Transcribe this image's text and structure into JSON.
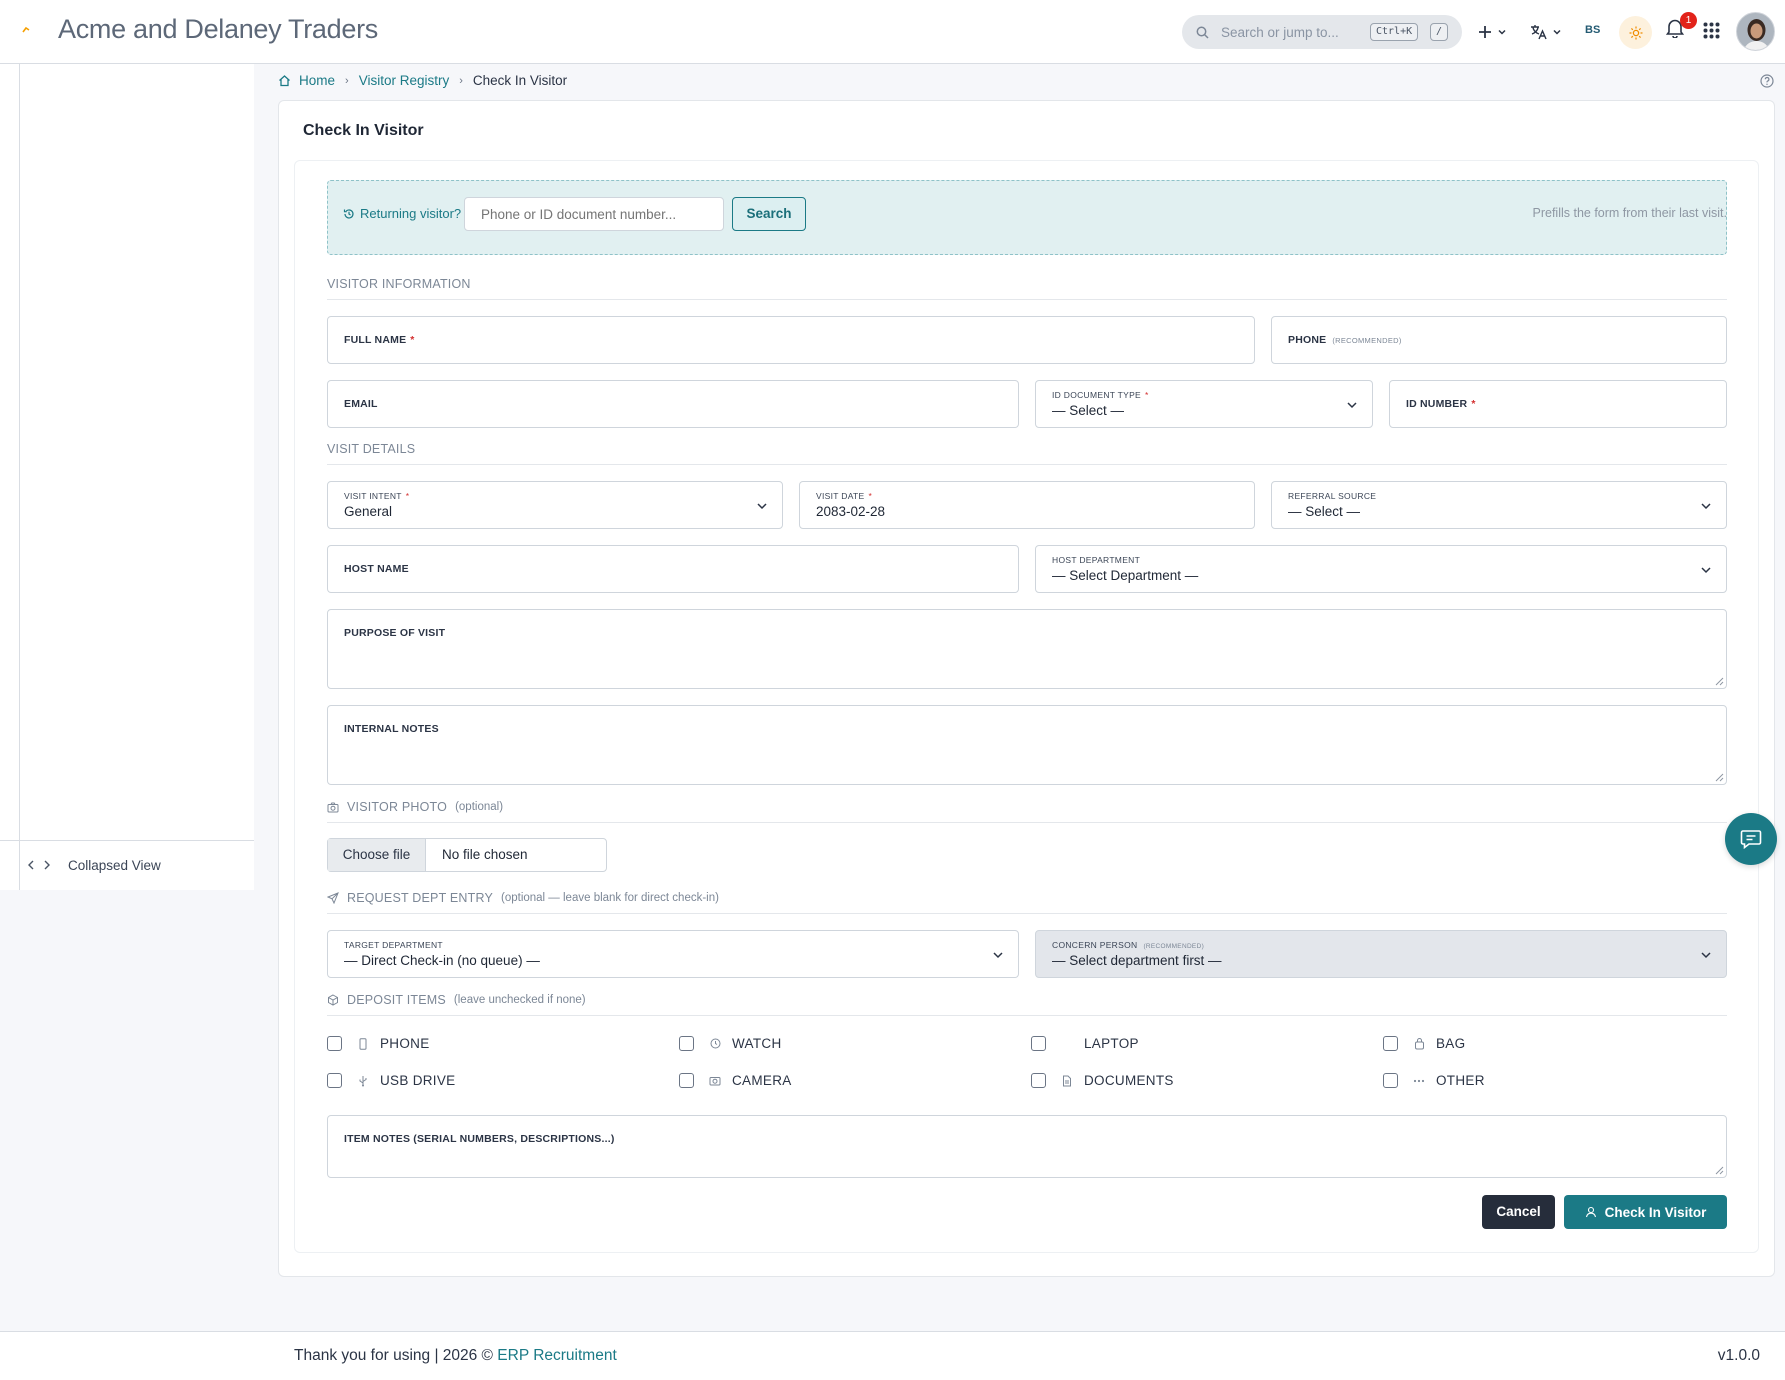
{
  "app": {
    "title": "Acme and Delaney Traders"
  },
  "search": {
    "placeholder": "Search or jump to...",
    "shortcut": "Ctrl+K",
    "slash": "/"
  },
  "header": {
    "user_initials": "BS",
    "notification_count": "1"
  },
  "sidebar": {
    "collapse_label": "Collapsed View"
  },
  "breadcrumb": {
    "home": "Home",
    "registry": "Visitor Registry",
    "current": "Check In Visitor"
  },
  "page": {
    "title": "Check In Visitor"
  },
  "returning": {
    "label": "Returning visitor?",
    "placeholder": "Phone or ID document number...",
    "button": "Search",
    "hint": "Prefills the form from their last visit."
  },
  "sections": {
    "visitor_info": "VISITOR INFORMATION",
    "visit_details": "VISIT DETAILS",
    "photo": "VISITOR PHOTO",
    "photo_opt": "(optional)",
    "dept_entry": "REQUEST DEPT ENTRY",
    "dept_entry_opt": "(optional — leave blank for direct check-in)",
    "deposit": "DEPOSIT ITEMS",
    "deposit_opt": "(leave unchecked if none)"
  },
  "fields": {
    "full_name": "FULL NAME",
    "phone": "PHONE",
    "recommended": "(RECOMMENDED)",
    "email": "EMAIL",
    "id_doc_type": "ID DOCUMENT TYPE",
    "id_doc_type_value": "— Select —",
    "id_number": "ID NUMBER",
    "visit_intent": "VISIT INTENT",
    "visit_intent_value": "General",
    "visit_date": "VISIT DATE",
    "visit_date_value": "2083-02-28",
    "referral_source": "REFERRAL SOURCE",
    "referral_source_value": "— Select —",
    "host_name": "HOST NAME",
    "host_department": "HOST DEPARTMENT",
    "host_department_value": "— Select Department —",
    "purpose": "PURPOSE OF VISIT",
    "internal_notes": "INTERNAL NOTES",
    "target_department": "TARGET DEPARTMENT",
    "target_department_value": "— Direct Check-in (no queue) —",
    "concern_person": "CONCERN PERSON",
    "concern_person_value": "— Select department first —",
    "item_notes": "ITEM NOTES (SERIAL NUMBERS, DESCRIPTIONS...)"
  },
  "file": {
    "choose": "Choose file",
    "status": "No file chosen"
  },
  "deposit_items": [
    "PHONE",
    "WATCH",
    "LAPTOP",
    "BAG",
    "USB DRIVE",
    "CAMERA",
    "DOCUMENTS",
    "OTHER"
  ],
  "actions": {
    "cancel": "Cancel",
    "submit": "Check In Visitor"
  },
  "footer": {
    "text": "Thank you for using | 2026 ©",
    "link": "ERP Recruitment",
    "version": "v1.0.0"
  },
  "colors": {
    "accent": "#1b7a86",
    "danger": "#d32f2f",
    "dark_button": "#262d3b"
  }
}
